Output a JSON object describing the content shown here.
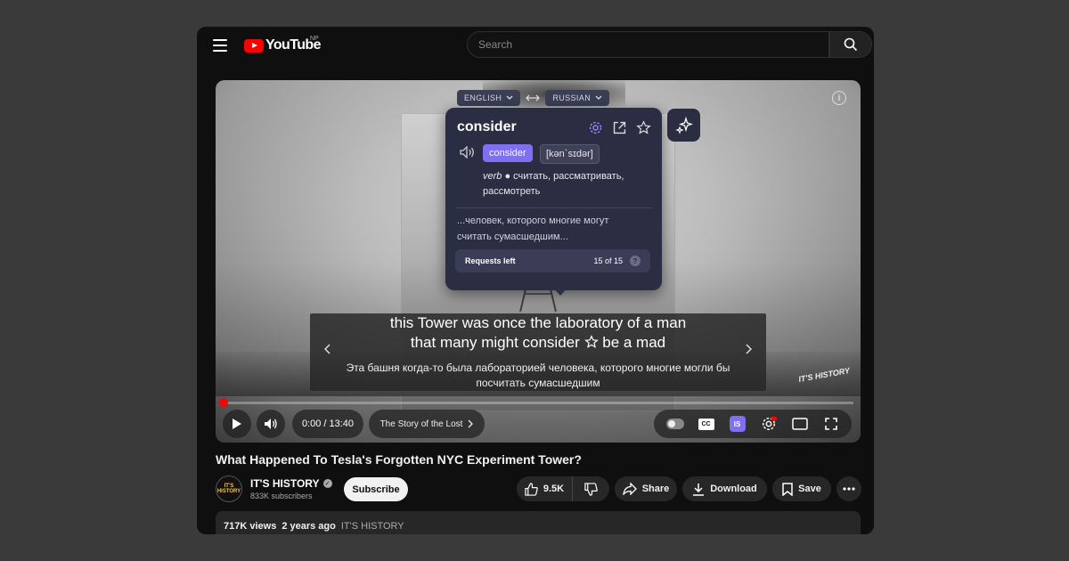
{
  "header": {
    "logo_text": "YouTube",
    "region": "NP",
    "search_placeholder": "Search"
  },
  "translator": {
    "source_lang": "ENGLISH",
    "target_lang": "RUSSIAN",
    "word": "consider",
    "word_chip": "consider",
    "ipa": "[kən`sɪdər]",
    "pos": "verb",
    "translations": "считать, рассматривать, рассмотреть",
    "context": "...человек, которого многие могут считать сумасшедшим...",
    "requests_label": "Requests left",
    "requests_value": "15 of 15",
    "accent_color": "#7f6ff2"
  },
  "subtitles": {
    "en_line1": "this Tower was once the laboratory of a man",
    "en_line2_a": "that many might consider",
    "en_line2_b": "be a mad",
    "ru": "Эта башня когда-то была лабораторией человека, которого многие могли бы посчитать сумасшедшим"
  },
  "player": {
    "watermark": "IT'S HISTORY",
    "time": "0:00 / 13:40",
    "chapter": "The Story of the Lost",
    "cc_label": "CC",
    "is_label": "IS",
    "progress": 0
  },
  "video": {
    "title": "What Happened To Tesla's Forgotten NYC Experiment Tower?",
    "channel": "IT'S HISTORY",
    "avatar_text": "IT'S HISTORY",
    "subscribers": "833K subscribers",
    "subscribe_label": "Subscribe",
    "likes": "9.5K",
    "share_label": "Share",
    "download_label": "Download",
    "save_label": "Save",
    "views": "717K views",
    "age": "2 years ago",
    "desc_channel": "IT'S HISTORY"
  }
}
